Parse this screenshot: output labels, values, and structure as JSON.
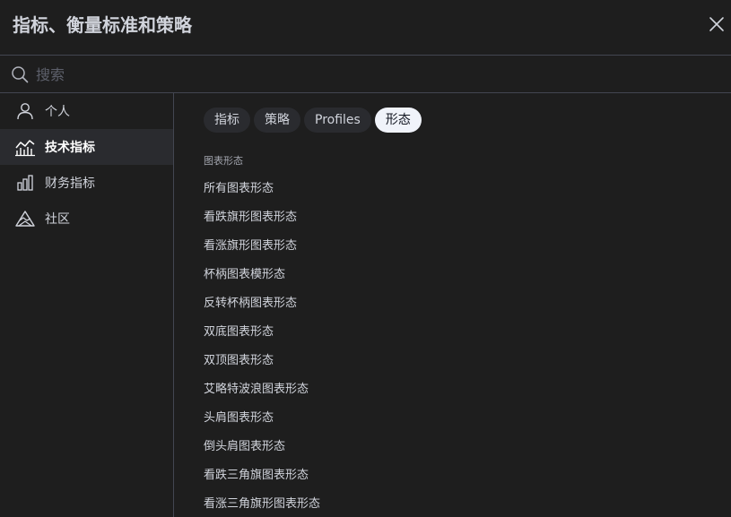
{
  "dialog": {
    "title": "指标、衡量标准和策略"
  },
  "search": {
    "placeholder": "搜索",
    "value": ""
  },
  "sidebar": {
    "items": [
      {
        "label": "个人",
        "icon": "user-icon",
        "active": false
      },
      {
        "label": "技术指标",
        "icon": "chart-line-icon",
        "active": true
      },
      {
        "label": "财务指标",
        "icon": "bar-chart-icon",
        "active": false
      },
      {
        "label": "社区",
        "icon": "mountain-icon",
        "active": false
      }
    ]
  },
  "tabs": [
    {
      "label": "指标",
      "active": false
    },
    {
      "label": "策略",
      "active": false
    },
    {
      "label": "Profiles",
      "active": false
    },
    {
      "label": "形态",
      "active": true
    }
  ],
  "section": {
    "title": "图表形态"
  },
  "patterns": [
    "所有图表形态",
    "看跌旗形图表形态",
    "看涨旗形图表形态",
    "杯柄图表模形态",
    "反转杯柄图表形态",
    "双底图表形态",
    "双顶图表形态",
    "艾略特波浪图表形态",
    "头肩图表形态",
    "倒头肩图表形态",
    "看跌三角旗图表形态",
    "看涨三角旗形图表形态"
  ]
}
